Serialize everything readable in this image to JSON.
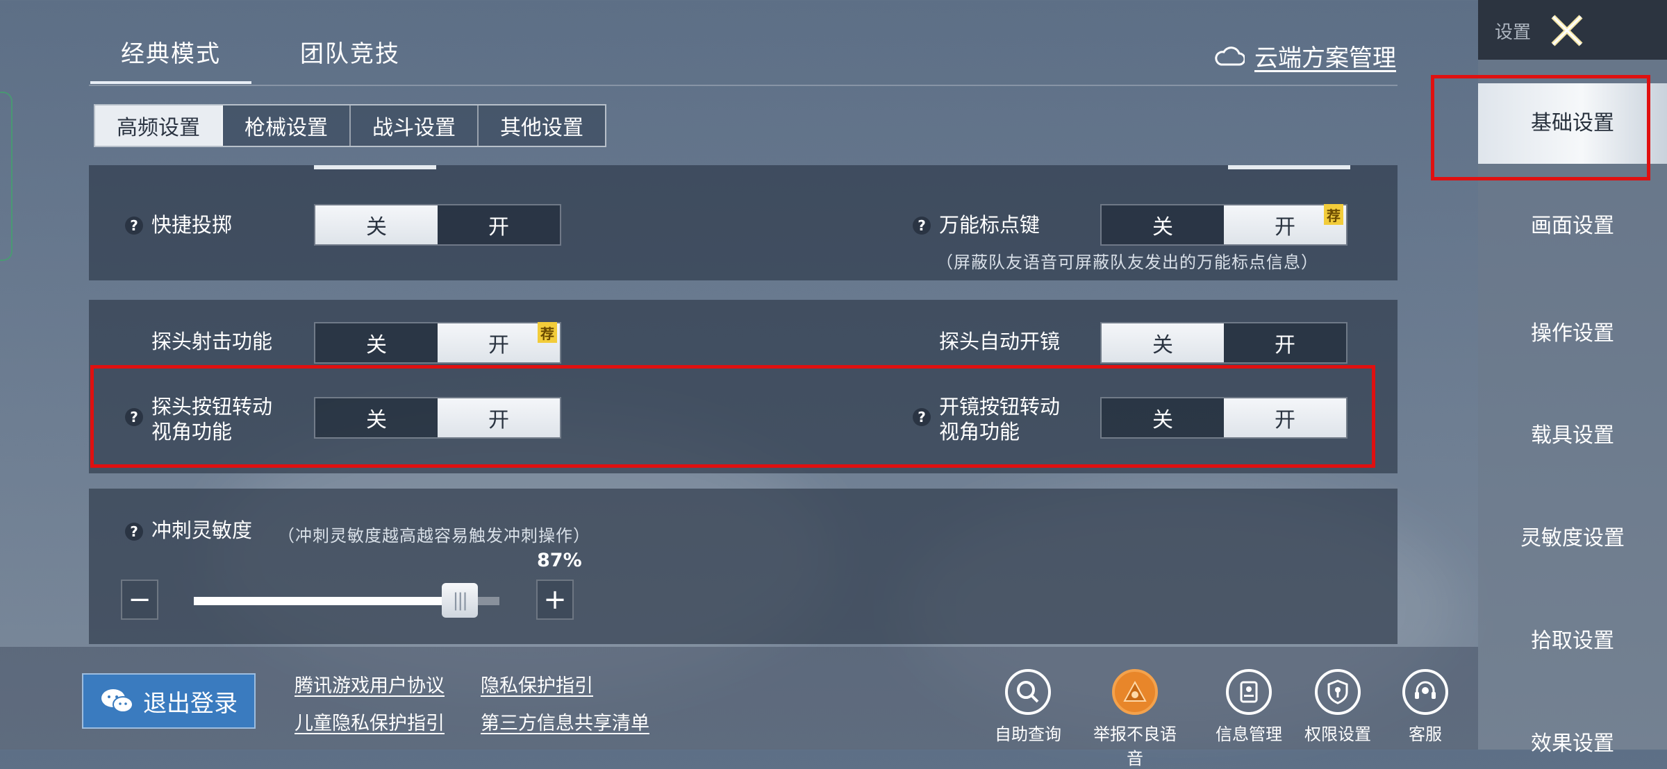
{
  "header": {
    "mode_tabs": [
      {
        "label": "经典模式",
        "active": true
      },
      {
        "label": "团队竞技",
        "active": false
      }
    ],
    "cloud_manage": "云端方案管理",
    "sub_tabs": [
      {
        "label": "高频设置",
        "active": true
      },
      {
        "label": "枪械设置",
        "active": false
      },
      {
        "label": "战斗设置",
        "active": false
      },
      {
        "label": "其他设置",
        "active": false
      }
    ]
  },
  "toggle_labels": {
    "off": "关",
    "on": "开",
    "recommend_badge": "荐"
  },
  "settings": {
    "quick_throw": {
      "label": "快捷投掷",
      "value": "off",
      "help": "?"
    },
    "universal_mark": {
      "label": "万能标点键",
      "value": "on",
      "recommended": true,
      "help": "?",
      "note": "（屏蔽队友语音可屏蔽队友发出的万能标点信息）"
    },
    "peek_shoot": {
      "label": "探头射击功能",
      "value": "on",
      "recommended": true
    },
    "peek_auto_scope": {
      "label": "探头自动开镜",
      "value": "off"
    },
    "peek_rotate_view": {
      "label_line1": "探头按钮转动",
      "label_line2": "视角功能",
      "value": "on",
      "help": "?"
    },
    "scope_rotate_view": {
      "label_line1": "开镜按钮转动",
      "label_line2": "视角功能",
      "value": "on",
      "help": "?"
    },
    "sprint_sensitivity": {
      "label": "冲刺灵敏度",
      "note": "（冲刺灵敏度越高越容易触发冲刺操作）",
      "value": 0.87,
      "display": "87%",
      "minus": "−",
      "plus": "+"
    }
  },
  "sidebar": {
    "title": "设置",
    "items": [
      {
        "label": "基础设置",
        "active": true
      },
      {
        "label": "画面设置",
        "active": false
      },
      {
        "label": "操作设置",
        "active": false
      },
      {
        "label": "载具设置",
        "active": false
      },
      {
        "label": "灵敏度设置",
        "active": false
      },
      {
        "label": "拾取设置",
        "active": false
      },
      {
        "label": "效果设置",
        "active": false
      }
    ]
  },
  "footer": {
    "logout": "退出登录",
    "links": [
      "腾讯游戏用户协议",
      "隐私保护指引",
      "儿童隐私保护指引",
      "第三方信息共享清单"
    ],
    "tools": [
      {
        "label": "自助查询",
        "icon": "search-icon"
      },
      {
        "label": "举报不良语音",
        "icon": "report-icon"
      },
      {
        "label": "信息管理",
        "icon": "profile-icon"
      },
      {
        "label": "权限设置",
        "icon": "shield-icon"
      },
      {
        "label": "客服",
        "icon": "headset-icon"
      }
    ]
  },
  "colors": {
    "highlight": "#e01010",
    "badge": "#f2cc3a",
    "logout_bg": "#3a7bbf"
  }
}
